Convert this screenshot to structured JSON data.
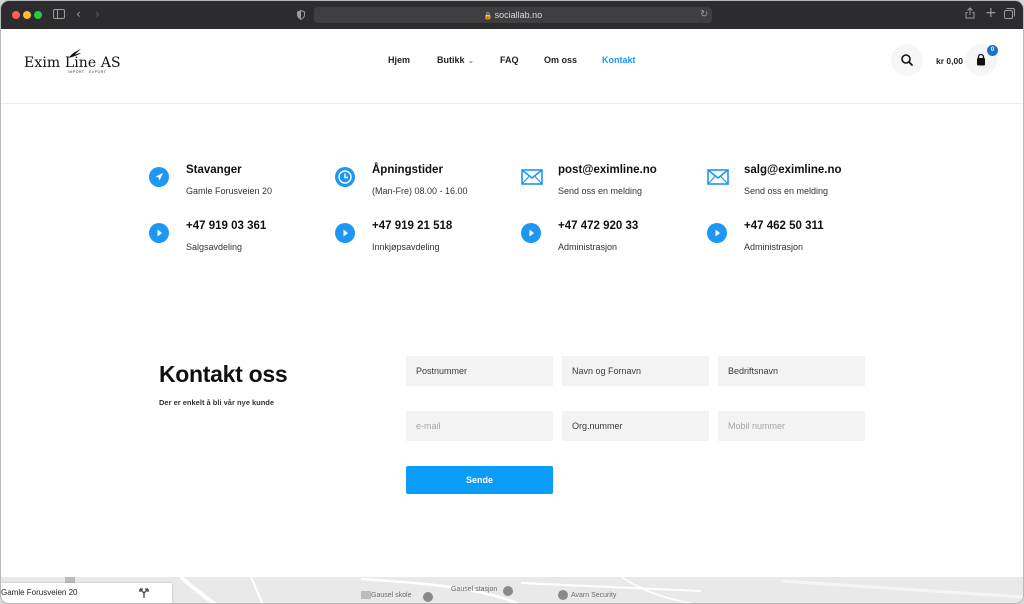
{
  "browser": {
    "url": "sociallab.no"
  },
  "header": {
    "logo": {
      "text": "Exim Line AS",
      "tagline": "IMPORT · EXPORT"
    },
    "nav": [
      {
        "label": "Hjem",
        "active": false
      },
      {
        "label": "Butikk",
        "active": false,
        "has_dropdown": true
      },
      {
        "label": "FAQ",
        "active": false
      },
      {
        "label": "Om oss",
        "active": false
      },
      {
        "label": "Kontakt",
        "active": true
      }
    ],
    "cart_total": "kr 0,00",
    "cart_count": "0"
  },
  "contact_info": [
    {
      "icon": "location-arrow-icon",
      "title": "Stavanger",
      "subtitle": "Gamle Forusveien 20"
    },
    {
      "icon": "clock-icon",
      "title": "Åpningstider",
      "subtitle": "(Man-Fre) 08.00 - 16.00"
    },
    {
      "icon": "envelope-icon",
      "title": "post@eximline.no",
      "subtitle": "Send oss en melding"
    },
    {
      "icon": "envelope-icon",
      "title": "salg@eximline.no",
      "subtitle": "Send oss en melding"
    },
    {
      "icon": "phone-play-icon",
      "title": "+47 919 03 361",
      "subtitle": "Salgsavdeling"
    },
    {
      "icon": "phone-play-icon",
      "title": "+47 919 21 518",
      "subtitle": "Innkjøpsavdeling"
    },
    {
      "icon": "phone-play-icon",
      "title": "+47 472 920 33",
      "subtitle": "Administrasjon"
    },
    {
      "icon": "phone-play-icon",
      "title": "+47 462 50 311",
      "subtitle": "Administrasjon"
    }
  ],
  "contact_form": {
    "title": "Kontakt oss",
    "subtitle": "Der er enkelt å bli vår nye kunde",
    "fields": [
      {
        "placeholder": "Postnummer"
      },
      {
        "placeholder": "Navn og Fornavn"
      },
      {
        "placeholder": "Bedriftsnavn"
      },
      {
        "placeholder": "e-mail"
      },
      {
        "placeholder": "Org.nummer"
      },
      {
        "placeholder": "Mobil nummer"
      }
    ],
    "submit_label": "Sende"
  },
  "map": {
    "card_title": "Gamle Forusveien 20",
    "labels": [
      "Gausel stasjon",
      "Gausel skole",
      "Avarn Security"
    ]
  },
  "colors": {
    "accent": "#1d97f3",
    "button": "#0a9cf7",
    "badge": "#1b73d1",
    "chrome": "#2c2c2e"
  }
}
